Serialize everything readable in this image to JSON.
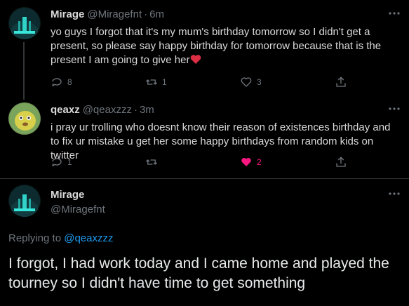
{
  "tweets": [
    {
      "display_name": "Mirage",
      "handle": "@Miragefnt",
      "time": "6m",
      "text": "yo guys I forgot that it's my mum's birthday tomorrow so I didn't get a present, so please say happy birthday for tomorrow because that is the present I am going to give her",
      "emoji": "heart",
      "replies": "8",
      "retweets": "1",
      "likes": "3"
    },
    {
      "display_name": "qeaxz",
      "handle": "@qeaxzzz",
      "time": "3m",
      "text": "i pray ur trolling who doesnt know their reason of existences birthday and to fix ur mistake u get her some happy birthdays from random kids on twitter",
      "replies": "1",
      "retweets": "",
      "likes": "2"
    }
  ],
  "focused": {
    "display_name": "Mirage",
    "handle": "@Miragefnt",
    "replying_prefix": "Replying to",
    "replying_to": "@qeaxzzz",
    "text": "I forgot, I had work today and I came home and played the tourney so I didn't have time to get something"
  },
  "colors": {
    "background": "#000000",
    "secondary_text": "#6e767d",
    "link": "#1d9bf0",
    "like": "#f91880"
  },
  "icons": {
    "reply": "reply-icon",
    "retweet": "retweet-icon",
    "like": "like-icon",
    "share": "share-icon",
    "more": "more-icon"
  }
}
